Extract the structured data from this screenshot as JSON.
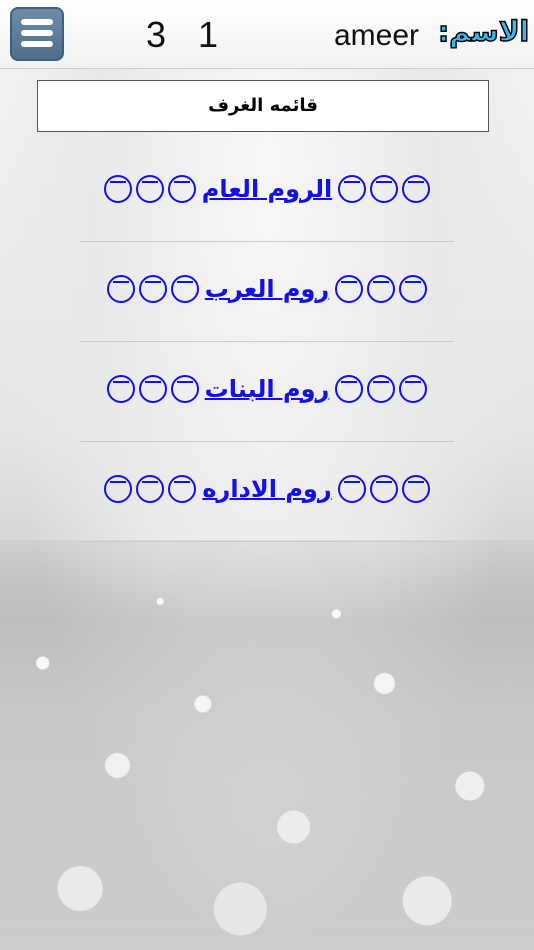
{
  "header": {
    "counter_left": "3",
    "counter_right": "1",
    "user_name": "ameer",
    "name_label": "الاسم:"
  },
  "rooms_title": "قائمه الغرف",
  "rooms": [
    {
      "label": "الروم العام"
    },
    {
      "label": "روم العرب"
    },
    {
      "label": "روم البنات"
    },
    {
      "label": "روم الاداره"
    }
  ],
  "colors": {
    "link": "#1410e8",
    "menu_button": "#5b7c9b",
    "name_label": "#36b9f2"
  },
  "icons": {
    "menu": "hamburger-menu-icon",
    "room_decoration": "circle-ornament-icon"
  }
}
